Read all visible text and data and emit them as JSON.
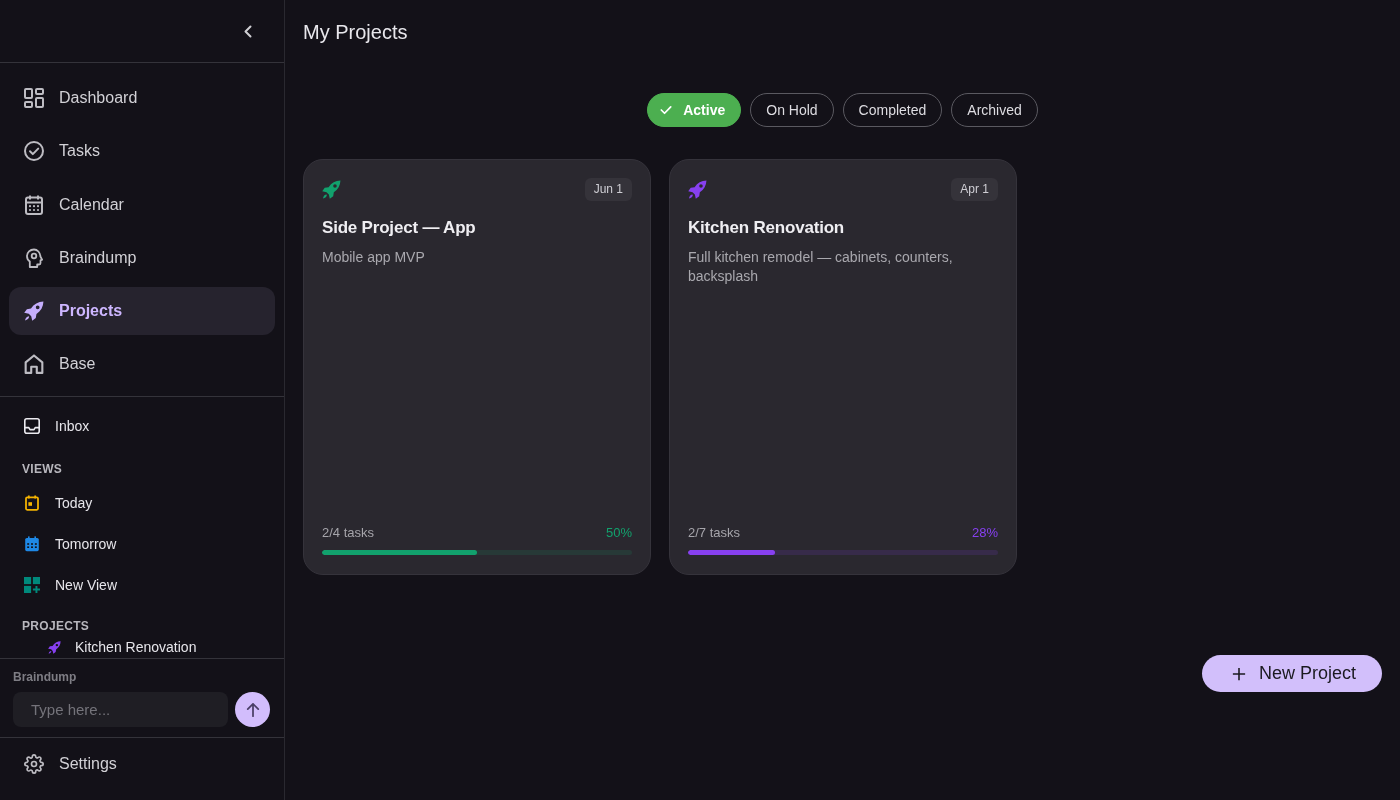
{
  "sidebar": {
    "nav": [
      {
        "kind": "dashboard",
        "label": "Dashboard",
        "selected": false
      },
      {
        "kind": "tasks",
        "label": "Tasks",
        "selected": false
      },
      {
        "kind": "calendar",
        "label": "Calendar",
        "selected": false
      },
      {
        "kind": "braindump",
        "label": "Braindump",
        "selected": false
      },
      {
        "kind": "projects",
        "label": "Projects",
        "selected": true
      },
      {
        "kind": "base",
        "label": "Base",
        "selected": false
      }
    ],
    "inbox": {
      "label": "Inbox"
    },
    "views_heading": "VIEWS",
    "views": [
      {
        "kind": "today",
        "label": "Today",
        "color": "#f5b400"
      },
      {
        "kind": "tomorrow",
        "label": "Tomorrow",
        "color": "#1e88e5"
      },
      {
        "kind": "new_view",
        "label": "New View",
        "color": "#00897b"
      }
    ],
    "projects_heading": "PROJECTS",
    "projects": [
      {
        "label": "Kitchen Renovation",
        "color": "#8740f0"
      }
    ],
    "braindump": {
      "label": "Braindump",
      "placeholder": "Type here..."
    },
    "settings": {
      "label": "Settings"
    }
  },
  "main": {
    "title": "My Projects",
    "filters": [
      {
        "label": "Active",
        "selected": true
      },
      {
        "label": "On Hold",
        "selected": false
      },
      {
        "label": "Completed",
        "selected": false
      },
      {
        "label": "Archived",
        "selected": false
      }
    ],
    "projects": [
      {
        "title": "Side Project — App",
        "date": "Jun 1",
        "description": "Mobile app MVP",
        "tasks": "2/4 tasks",
        "percent": "50%",
        "level": 0.5,
        "color": "#12a16d"
      },
      {
        "title": "Kitchen Renovation",
        "date": "Apr 1",
        "description": "Full kitchen remodel — cabinets, counters, backsplash",
        "tasks": "2/7 tasks",
        "percent": "28%",
        "level": 0.28,
        "color": "#8740f0"
      }
    ],
    "new_project_button": {
      "label": "New Project"
    }
  }
}
